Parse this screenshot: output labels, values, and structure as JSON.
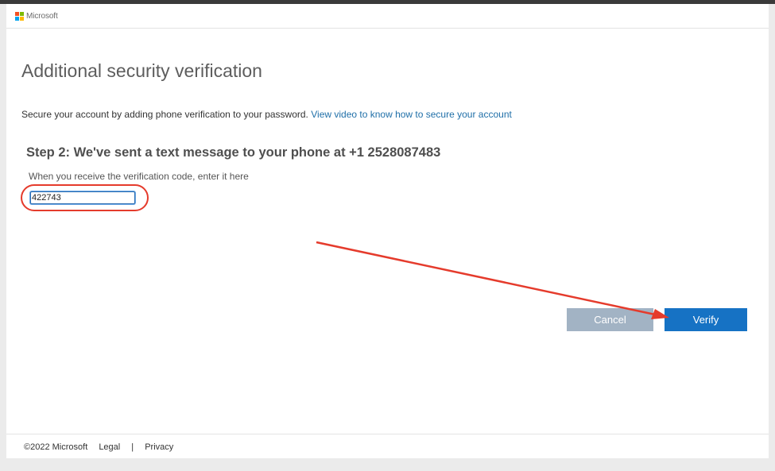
{
  "header": {
    "brand": "Microsoft",
    "logo_colors": [
      "#f25022",
      "#7fba00",
      "#00a4ef",
      "#ffb900"
    ]
  },
  "main": {
    "title": "Additional security verification",
    "intro_text": "Secure your account by adding phone verification to your password.",
    "intro_link": "View video to know how to secure your account",
    "step_heading": "Step 2: We've sent a text message to your phone at +1 2528087483",
    "code_hint": "When you receive the verification code, enter it here",
    "code_value": "422743"
  },
  "actions": {
    "cancel_label": "Cancel",
    "verify_label": "Verify"
  },
  "annotation": {
    "color": "#e53b2c"
  },
  "footer": {
    "copyright": "©2022 Microsoft",
    "legal": "Legal",
    "separator": "|",
    "privacy": "Privacy"
  },
  "colors": {
    "link": "#1f6fa8",
    "primary_button": "#1672c4",
    "disabled_button": "#a2b3c4"
  }
}
